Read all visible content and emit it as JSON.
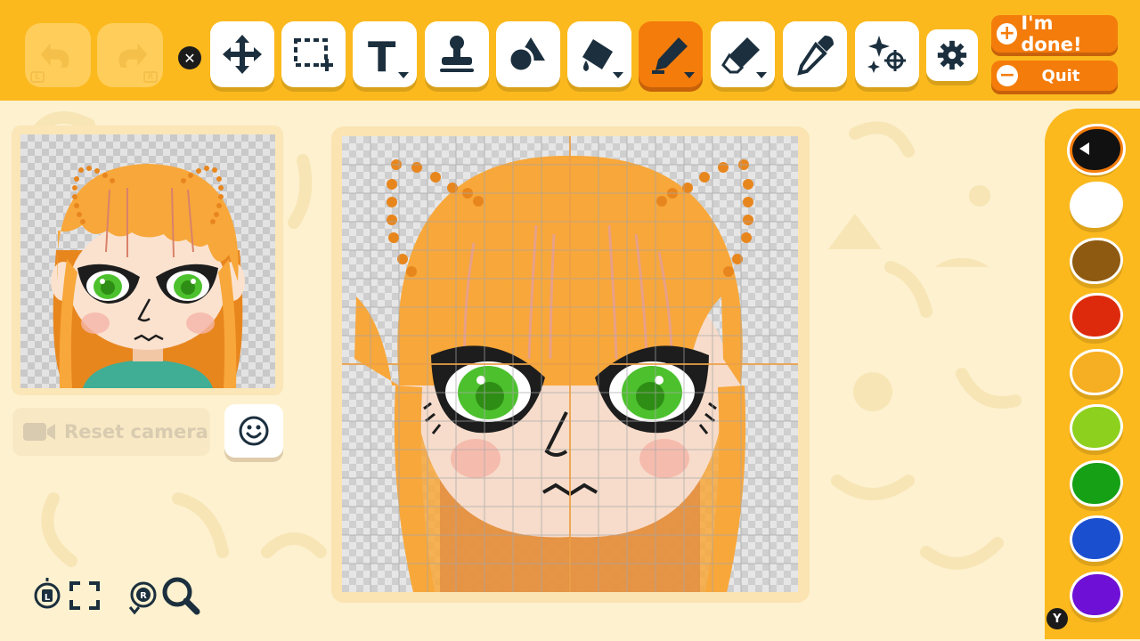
{
  "toolbar": {
    "undo": {
      "icon": "undo-icon",
      "key": "L"
    },
    "redo": {
      "icon": "redo-icon",
      "key": "R"
    },
    "close_key": "✕",
    "tools": [
      {
        "id": "move",
        "icon": "move-arrows-icon"
      },
      {
        "id": "select",
        "icon": "marquee-select-icon"
      },
      {
        "id": "text",
        "icon": "text-tool-icon",
        "glyph": "T"
      },
      {
        "id": "stamp",
        "icon": "stamp-icon"
      },
      {
        "id": "shapes",
        "icon": "shapes-icon"
      },
      {
        "id": "fill",
        "icon": "paint-bucket-icon"
      },
      {
        "id": "pen",
        "icon": "pen-icon",
        "active": true
      },
      {
        "id": "eraser",
        "icon": "eraser-icon"
      },
      {
        "id": "eyedropper",
        "icon": "eyedropper-icon"
      },
      {
        "id": "effects",
        "icon": "sparkle-effects-icon"
      },
      {
        "id": "settings",
        "icon": "gear-icon"
      }
    ],
    "done_label": "I'm done!",
    "done_symbol": "+",
    "quit_label": "Quit",
    "quit_symbol": "−"
  },
  "preview": {
    "reset_camera_label": "Reset camera",
    "face_icon": "smiley-face-icon"
  },
  "controls": {
    "key_l": "L",
    "key_r": "R"
  },
  "palette": {
    "key": "Y",
    "colors": [
      {
        "name": "black",
        "hex": "#111111",
        "selected": true
      },
      {
        "name": "white",
        "hex": "#ffffff"
      },
      {
        "name": "brown",
        "hex": "#8e5a12"
      },
      {
        "name": "red",
        "hex": "#dd2a0d"
      },
      {
        "name": "orange",
        "hex": "#f6ae22"
      },
      {
        "name": "lime",
        "hex": "#8dd01e"
      },
      {
        "name": "green",
        "hex": "#16a016"
      },
      {
        "name": "blue",
        "hex": "#1a4fd0"
      },
      {
        "name": "purple",
        "hex": "#6f10d6"
      }
    ]
  },
  "colors": {
    "toolbar_bg": "#fbb91e",
    "accent": "#f47c0b",
    "page_bg": "#fdf1cf",
    "hair": "#f8a73a",
    "eye_green": "#4cc12d"
  }
}
